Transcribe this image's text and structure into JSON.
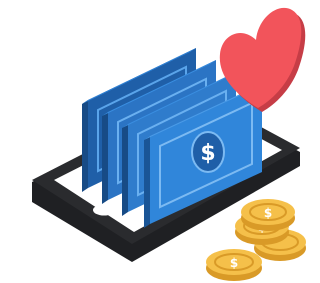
{
  "illustration": {
    "subject": "isometric-tablet-with-money-and-heart",
    "icons": [
      "tablet-icon",
      "banknote-stack-icon",
      "dollar-sign-icon",
      "heart-icon",
      "gold-coin-icon"
    ],
    "colors": {
      "tablet_frame": "#2a2b2e",
      "tablet_screen": "#ffffff",
      "banknote_blue": "#2f82d6",
      "banknote_dark": "#1f5fa8",
      "heart_red": "#f2545b",
      "heart_dark": "#c63d46",
      "coin_gold": "#f5c04a",
      "coin_dark": "#d99a27"
    },
    "banknote_count": 4,
    "coin_count": 4
  }
}
